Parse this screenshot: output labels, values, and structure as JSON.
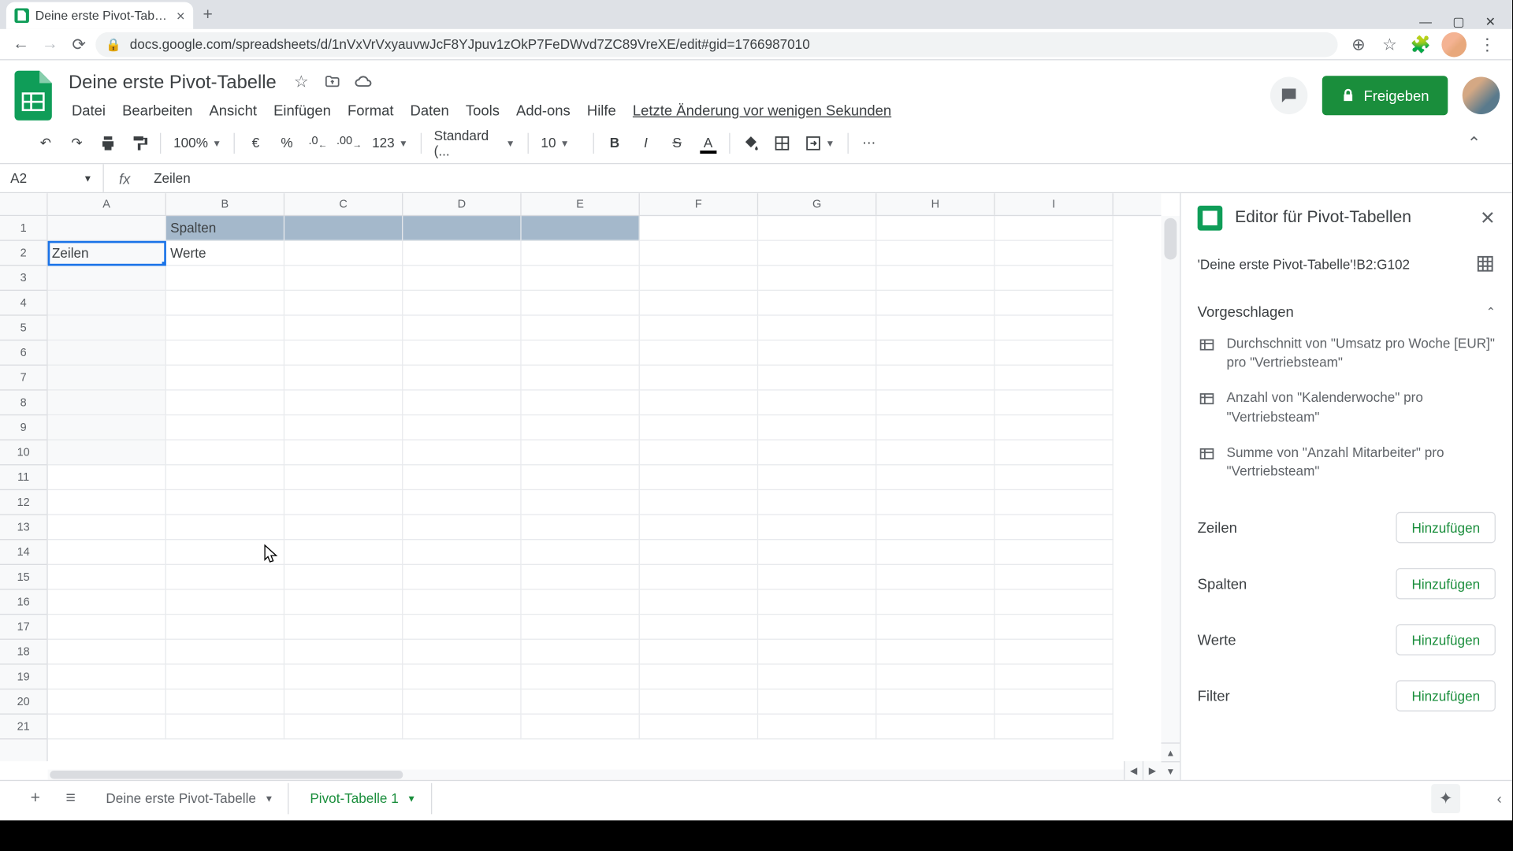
{
  "browser": {
    "tab_title": "Deine erste Pivot-Tabelle - Goog",
    "url": "docs.google.com/spreadsheets/d/1nVxVrVxyauvwJcF8YJpuv1zOkP7FeDWvd7ZC89VreXE/edit#gid=1766987010"
  },
  "doc": {
    "title": "Deine erste Pivot-Tabelle",
    "last_edit": "Letzte Änderung vor wenigen Sekunden",
    "share_label": "Freigeben"
  },
  "menus": [
    "Datei",
    "Bearbeiten",
    "Ansicht",
    "Einfügen",
    "Format",
    "Daten",
    "Tools",
    "Add-ons",
    "Hilfe"
  ],
  "toolbar": {
    "zoom": "100%",
    "currency": "€",
    "percent": "%",
    "dec_less": ".0",
    "dec_more": ".00",
    "num_format": "123",
    "font": "Standard (...",
    "font_size": "10"
  },
  "namebox": "A2",
  "formula": "Zeilen",
  "columns": [
    "A",
    "B",
    "C",
    "D",
    "E",
    "F",
    "G",
    "H",
    "I"
  ],
  "rows": [
    1,
    2,
    3,
    4,
    5,
    6,
    7,
    8,
    9,
    10,
    11,
    12,
    13,
    14,
    15,
    16,
    17,
    18,
    19,
    20,
    21
  ],
  "cells": {
    "B1": "Spalten",
    "A2": "Zeilen",
    "B2": "Werte"
  },
  "panel": {
    "title": "Editor für Pivot-Tabellen",
    "range": "'Deine erste Pivot-Tabelle'!B2:G102",
    "suggested_label": "Vorgeschlagen",
    "suggestions": [
      "Durchschnitt von \"Umsatz pro Woche [EUR]\" pro \"Vertriebsteam\"",
      "Anzahl von \"Kalenderwoche\" pro \"Vertriebsteam\"",
      "Summe von \"Anzahl Mitarbeiter\" pro \"Vertriebsteam\""
    ],
    "fields": {
      "rows": "Zeilen",
      "cols": "Spalten",
      "vals": "Werte",
      "filter": "Filter"
    },
    "add_label": "Hinzufügen"
  },
  "sheets": {
    "tab1": "Deine erste Pivot-Tabelle",
    "tab2": "Pivot-Tabelle 1"
  }
}
